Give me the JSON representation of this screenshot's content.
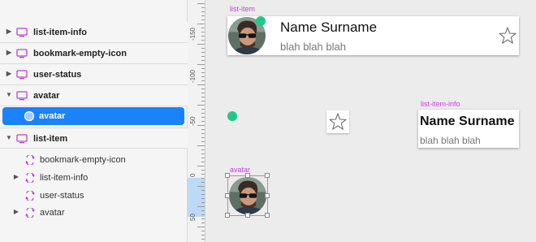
{
  "layers": {
    "top_items": [
      {
        "label": "list-item-info"
      },
      {
        "label": "bookmark-empty-icon"
      },
      {
        "label": "user-status"
      }
    ],
    "avatar_group": {
      "label": "avatar",
      "child": "avatar"
    },
    "list_item_group": {
      "label": "list-item",
      "children": [
        {
          "label": "bookmark-empty-icon"
        },
        {
          "label": "list-item-info"
        },
        {
          "label": "user-status"
        },
        {
          "label": "avatar"
        }
      ]
    }
  },
  "ruler": {
    "labels": [
      "-150",
      "-100",
      "-50",
      "0",
      "50"
    ]
  },
  "canvas": {
    "list_item_label": "list-item",
    "card_name": "Name Surname",
    "card_status": "blah blah blah",
    "info_label": "list-item-info",
    "info_name": "Name Surname",
    "info_status": "blah blah blah",
    "avatar_label": "avatar"
  },
  "colors": {
    "accent": "#1a82fb",
    "artboard_label": "#c23fd9",
    "status_dot": "#1ec98a",
    "symbol_icon": "#b544d6"
  },
  "icons": {
    "group": "monitor-icon",
    "symbol": "symbol-instance-icon",
    "oval": "oval-icon",
    "star": "star-icon"
  }
}
